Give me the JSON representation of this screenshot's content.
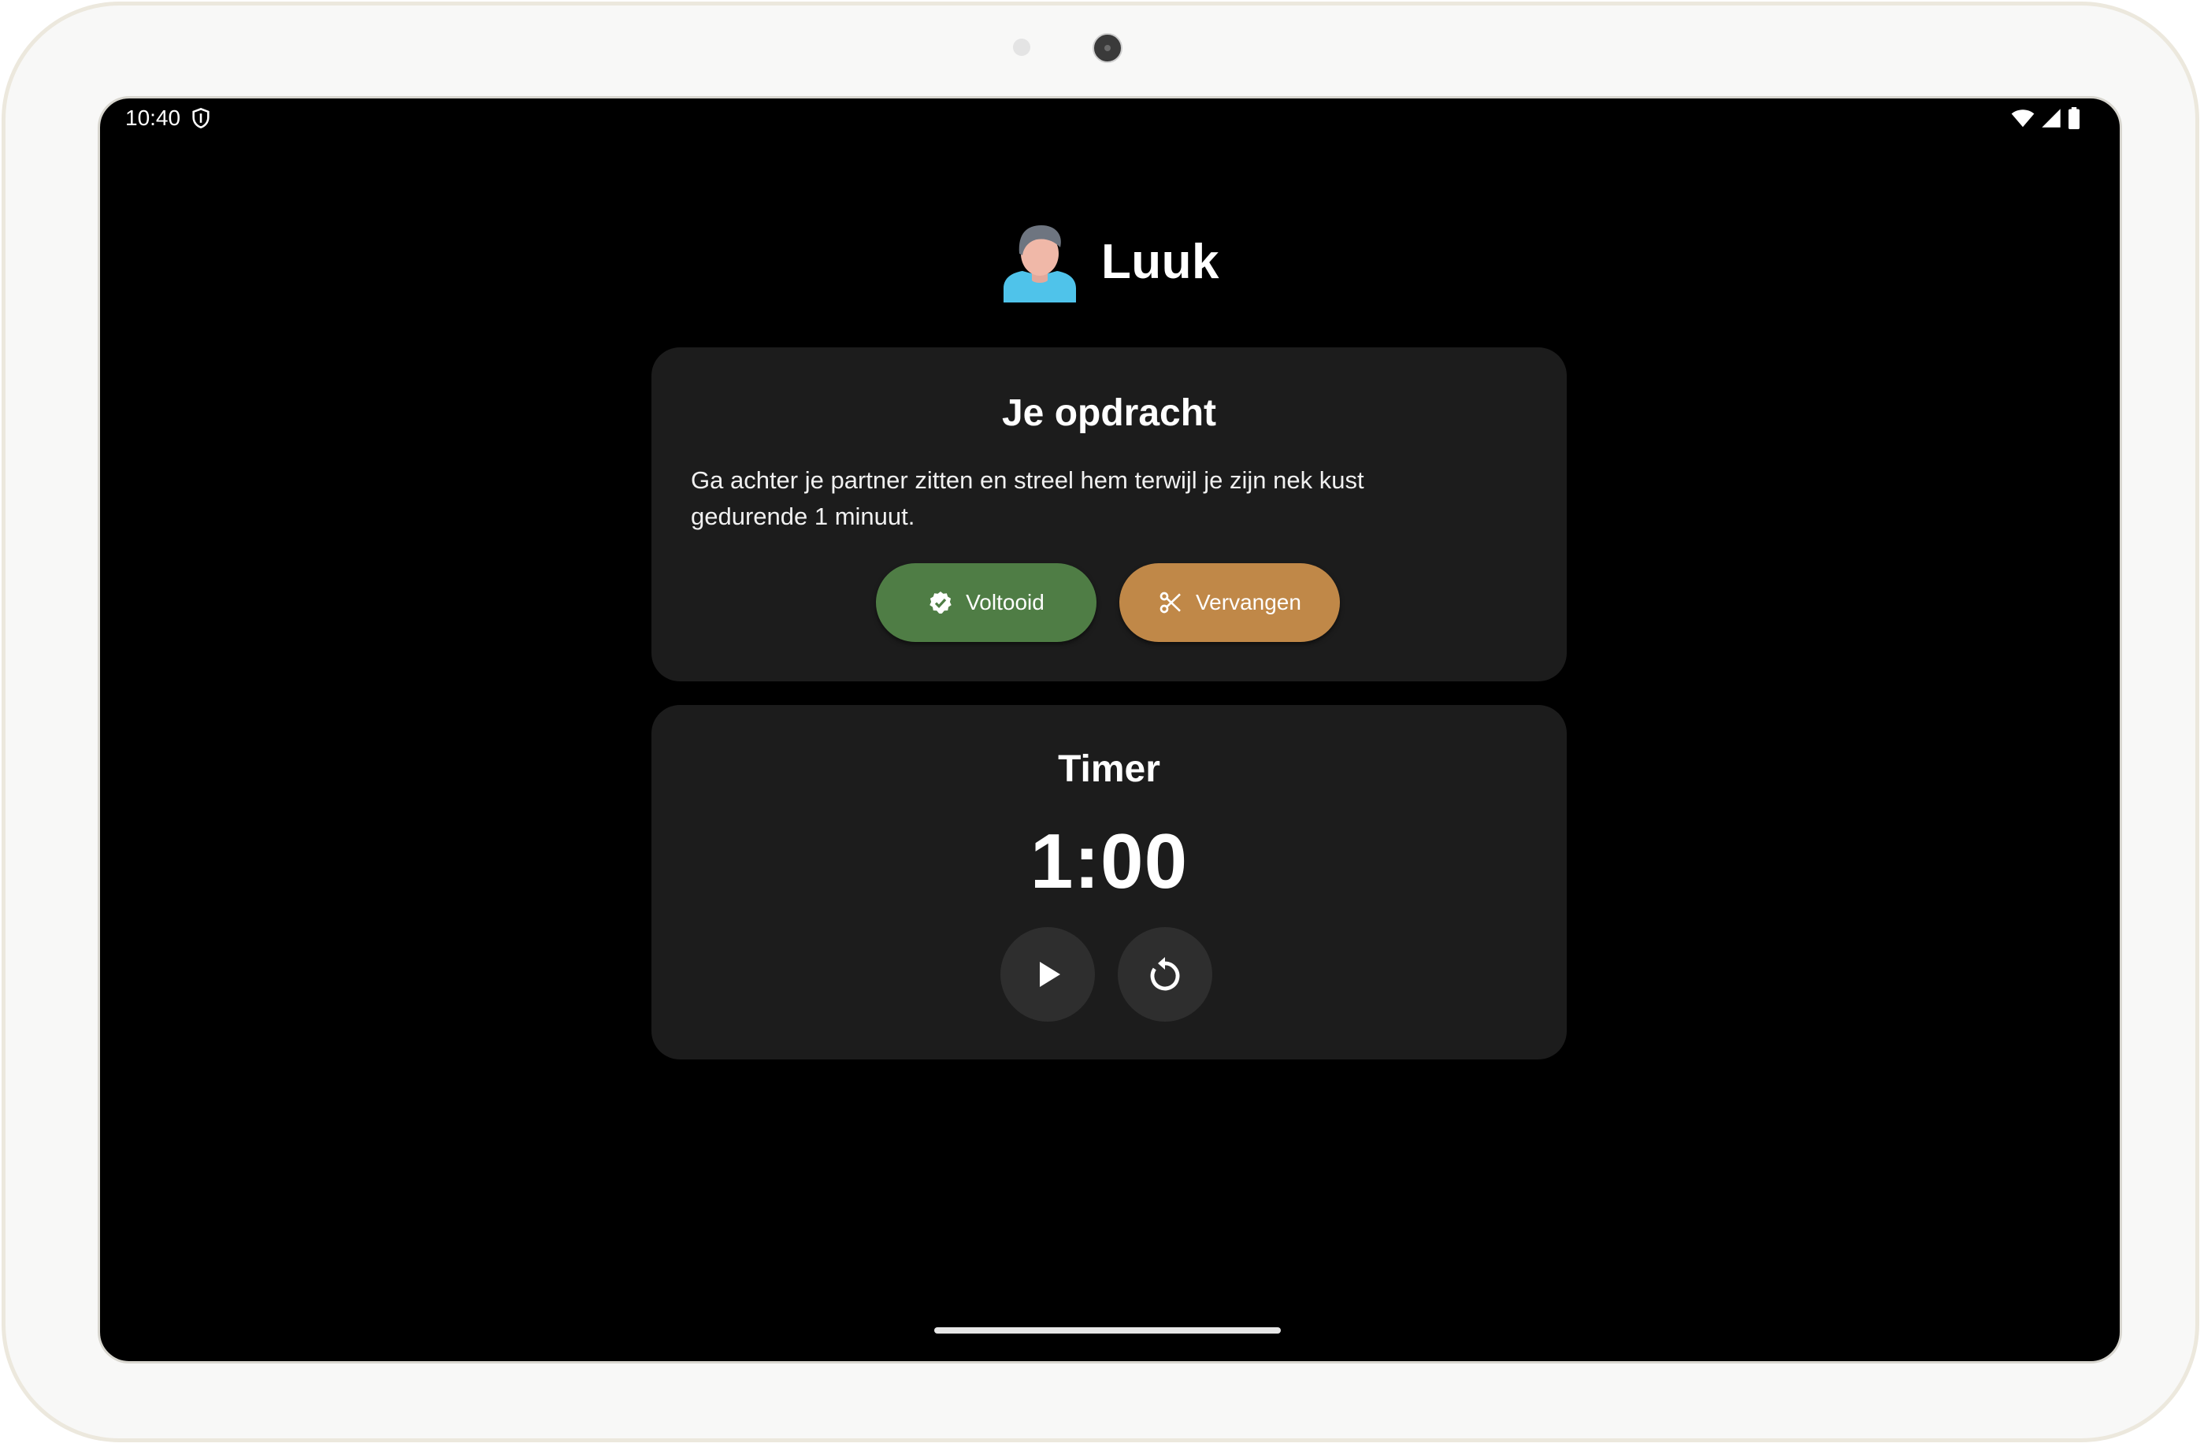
{
  "status_bar": {
    "time": "10:40",
    "icons": [
      "shield-icon",
      "wifi-icon",
      "signal-icon",
      "battery-icon"
    ]
  },
  "player": {
    "name": "Luuk",
    "avatar_icon": "person-avatar-icon"
  },
  "task_card": {
    "title": "Je opdracht",
    "text": "Ga achter je partner zitten en streel hem terwijl je zijn nek kust gedurende 1 minuut.",
    "done_button": {
      "label": "Voltooid",
      "icon": "check-badge-icon",
      "color": "#4f7d45"
    },
    "replace_button": {
      "label": "Vervangen",
      "icon": "scissors-icon",
      "color": "#c08848"
    }
  },
  "timer_card": {
    "title": "Timer",
    "value": "1:00",
    "play_icon": "play-icon",
    "reset_icon": "reset-icon"
  },
  "colors": {
    "background": "#000000",
    "card": "#1c1c1c",
    "round_button": "#2e2e2e"
  }
}
